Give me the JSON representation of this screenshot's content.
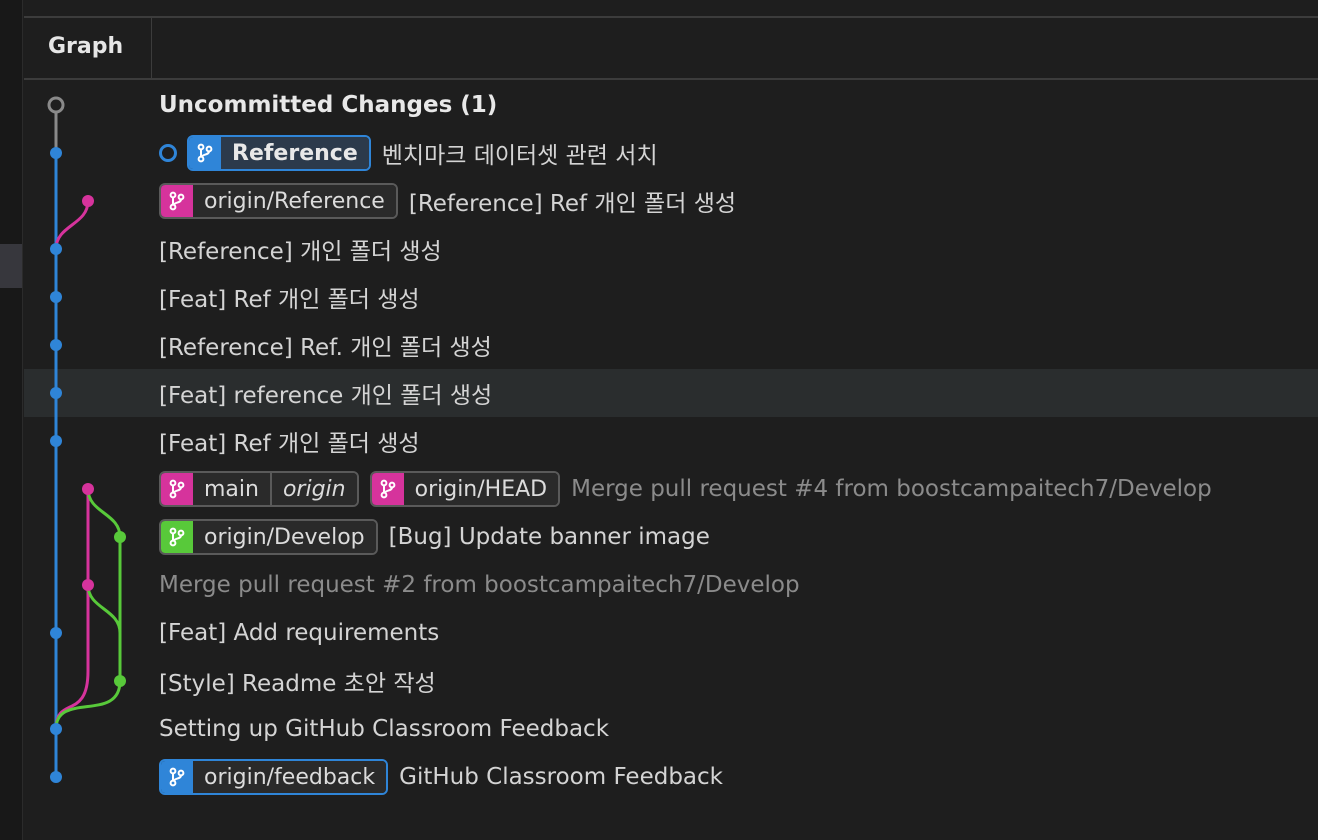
{
  "header": {
    "graph_label": "Graph"
  },
  "colors": {
    "blue": "#2f85d8",
    "pink": "#d6339c",
    "green": "#58c93a",
    "gray": "#8a8a8a"
  },
  "rows": [
    {
      "message": "Uncommitted Changes (1)",
      "style": "bold",
      "badges": []
    },
    {
      "message": "벤치마크 데이터셋 관련 서치",
      "head": true,
      "badges": [
        {
          "label": "Reference",
          "color": "blue",
          "strong": true
        }
      ]
    },
    {
      "message": "[Reference] Ref 개인 폴더 생성",
      "badges": [
        {
          "label": "origin/Reference",
          "color": "pink"
        }
      ]
    },
    {
      "message": "[Reference] 개인 폴더 생성",
      "badges": []
    },
    {
      "message": "[Feat] Ref 개인 폴더 생성",
      "badges": []
    },
    {
      "message": "[Reference] Ref. 개인 폴더 생성",
      "badges": []
    },
    {
      "message": "[Feat] reference 개인 폴더 생성",
      "selected": true,
      "badges": []
    },
    {
      "message": "[Feat] Ref 개인 폴더 생성",
      "badges": []
    },
    {
      "message": "Merge pull request #4 from boostcampaitech7/Develop",
      "style": "dim",
      "badges": [
        {
          "label": "main",
          "color": "pink",
          "remote": "origin"
        },
        {
          "label": "origin/HEAD",
          "color": "pink"
        }
      ]
    },
    {
      "message": "[Bug] Update banner image",
      "badges": [
        {
          "label": "origin/Develop",
          "color": "green"
        }
      ]
    },
    {
      "message": "Merge pull request #2 from boostcampaitech7/Develop",
      "style": "dim",
      "badges": []
    },
    {
      "message": "[Feat] Add requirements",
      "badges": []
    },
    {
      "message": "[Style] Readme 초안 작성",
      "badges": []
    },
    {
      "message": "Setting up GitHub Classroom Feedback",
      "badges": []
    },
    {
      "message": "GitHub Classroom Feedback",
      "badges": [
        {
          "label": "origin/feedback",
          "color": "blue"
        }
      ]
    }
  ]
}
